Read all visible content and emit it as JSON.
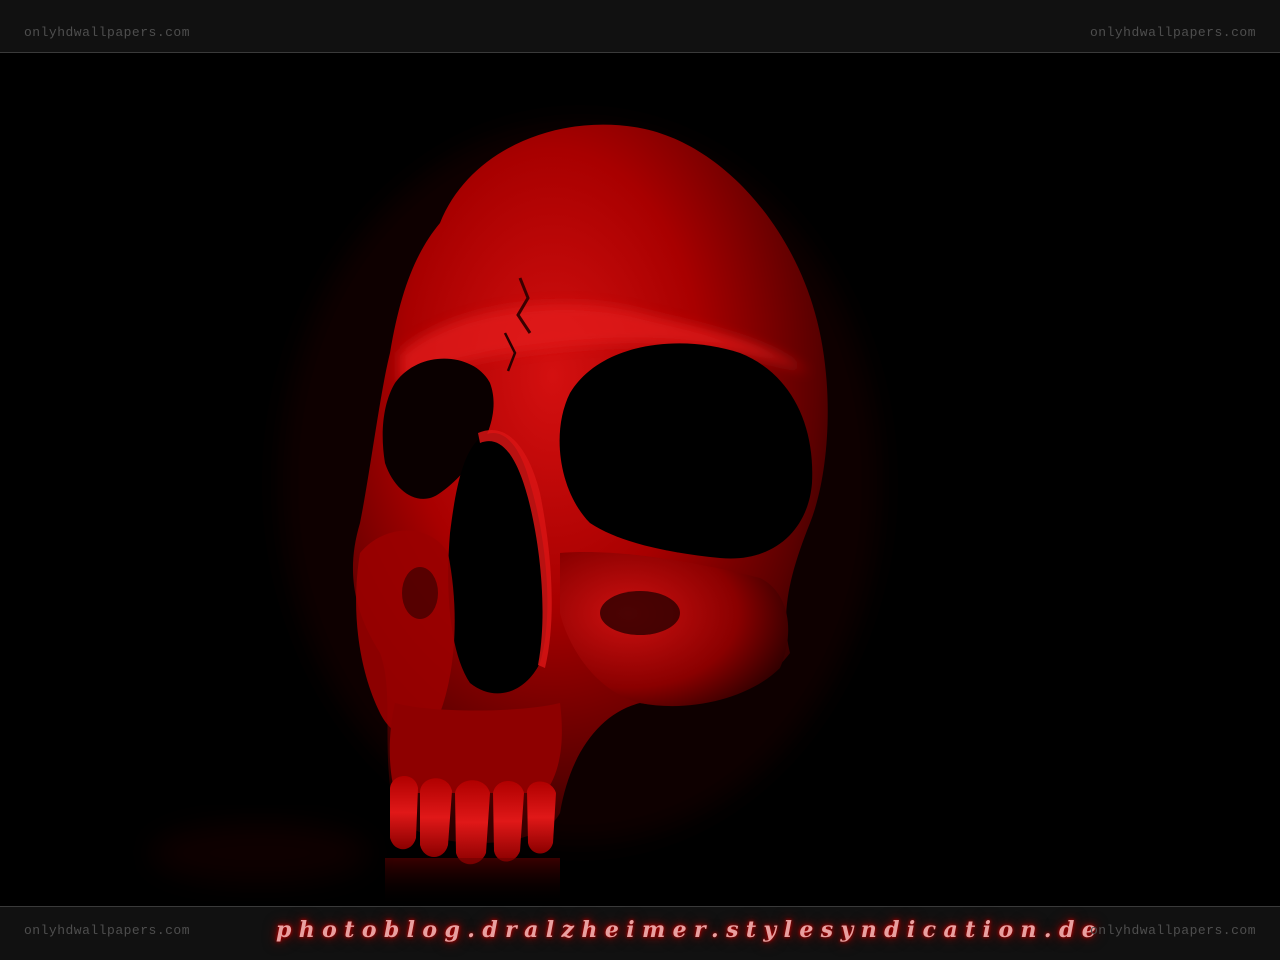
{
  "watermarks": {
    "top_left": "onlyhdwallpapers.com",
    "top_right": "onlyhdwallpapers.com",
    "bottom_left": "onlyhdwallpapers.com",
    "bottom_right": "onlyhdwallpapers.com"
  },
  "credit": "photoblog.dralzheimer.stylesyndication.de",
  "colors": {
    "background": "#000000",
    "bar": "#111111",
    "skull_red": "#b00000",
    "skull_highlight": "#e01818",
    "watermark": "#4e4e4e",
    "credit_glow": "#c00000"
  }
}
